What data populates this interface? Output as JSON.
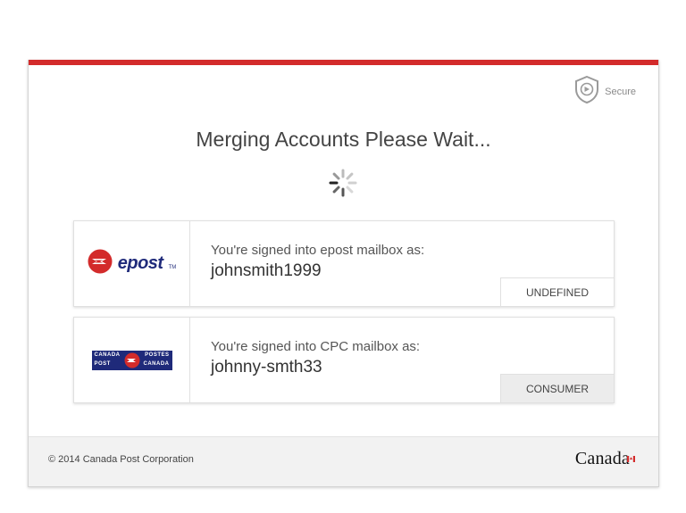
{
  "header": {
    "secure_label": "Secure"
  },
  "main": {
    "title": "Merging Accounts Please Wait..."
  },
  "accounts": [
    {
      "brand": "epost",
      "label": "You're signed into epost mailbox as:",
      "username": "johnsmith1999",
      "badge": "UNDEFINED"
    },
    {
      "brand": "canada-post",
      "label": "You're signed into CPC mailbox as:",
      "username": "johnny-smth33",
      "badge": "CONSUMER"
    }
  ],
  "logos": {
    "epost_text": "epost",
    "epost_tm": "TM",
    "cp_canada": "CANADA",
    "cp_postes": "POSTES",
    "cp_post": "POST",
    "cp_canada_fr": "CANADA"
  },
  "footer": {
    "copyright": "© 2014 Canada Post Corporation",
    "wordmark": "Canada"
  },
  "colors": {
    "accent_red": "#d32b2b",
    "brand_navy": "#1f2a7a"
  }
}
